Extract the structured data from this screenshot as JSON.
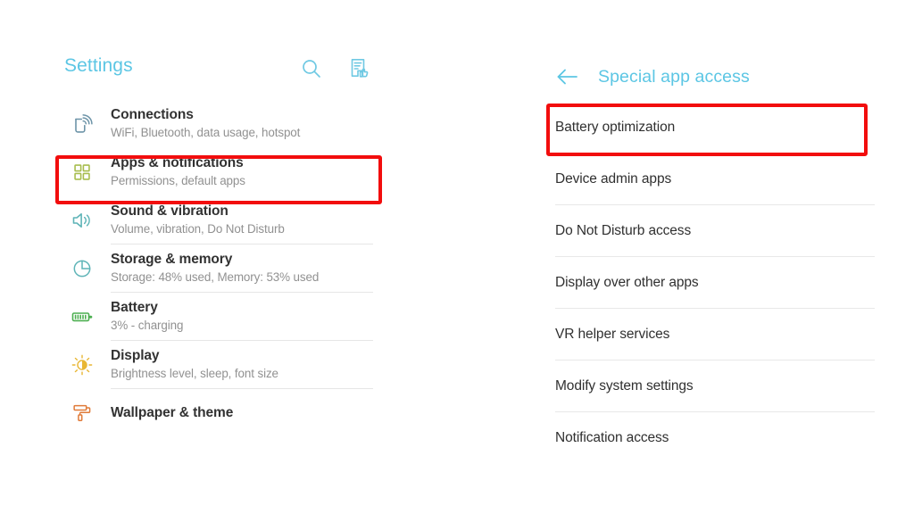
{
  "theme": {
    "accent_blue": "#5cc6e4",
    "highlight_red": "#f20d0d",
    "title_text": "#323232",
    "subtitle_text": "#919191",
    "divider": "#e6e6e6",
    "background": "#ffffff"
  },
  "left_panel": {
    "header": {
      "title": "Settings",
      "search_icon": "search-icon",
      "feedback_icon": "feedback-document-thumbsup-icon"
    },
    "items": [
      {
        "title": "Connections",
        "subtitle": "WiFi, Bluetooth, data usage, hotspot",
        "icon": "phone-wifi-signal-icon",
        "icon_color": "#6d94a8",
        "highlighted": false,
        "divider": false
      },
      {
        "title": "Apps & notifications",
        "subtitle": "Permissions, default apps",
        "icon": "four-squares-apps-icon",
        "icon_color": "#a7bd4e",
        "highlighted": true,
        "divider": false
      },
      {
        "title": "Sound & vibration",
        "subtitle": "Volume, vibration, Do Not Disturb",
        "icon": "speaker-volume-icon",
        "icon_color": "#5eb4b7",
        "highlighted": false,
        "divider": true
      },
      {
        "title": "Storage & memory",
        "subtitle": "Storage: 48% used, Memory: 53% used",
        "icon": "pie-chart-storage-icon",
        "icon_color": "#5eb4b7",
        "highlighted": false,
        "divider": true
      },
      {
        "title": "Battery",
        "subtitle": "3% - charging",
        "icon": "battery-icon",
        "icon_color": "#4caf50",
        "highlighted": false,
        "divider": true
      },
      {
        "title": "Display",
        "subtitle": "Brightness level, sleep, font size",
        "icon": "brightness-sun-icon",
        "icon_color": "#e8b633",
        "highlighted": false,
        "divider": true
      },
      {
        "title": "Wallpaper & theme",
        "subtitle": "",
        "icon": "paint-roller-icon",
        "icon_color": "#e07b39",
        "highlighted": false,
        "divider": false
      }
    ]
  },
  "right_panel": {
    "header": {
      "title": "Special app access",
      "back_icon": "back-arrow-icon"
    },
    "items": [
      {
        "label": "Battery optimization",
        "highlighted": true,
        "divider": false
      },
      {
        "label": "Device admin apps",
        "highlighted": false,
        "divider": true
      },
      {
        "label": "Do Not Disturb access",
        "highlighted": false,
        "divider": true
      },
      {
        "label": "Display over other apps",
        "highlighted": false,
        "divider": true
      },
      {
        "label": "VR helper services",
        "highlighted": false,
        "divider": true
      },
      {
        "label": "Modify system settings",
        "highlighted": false,
        "divider": true
      },
      {
        "label": "Notification access",
        "highlighted": false,
        "divider": false
      }
    ]
  }
}
